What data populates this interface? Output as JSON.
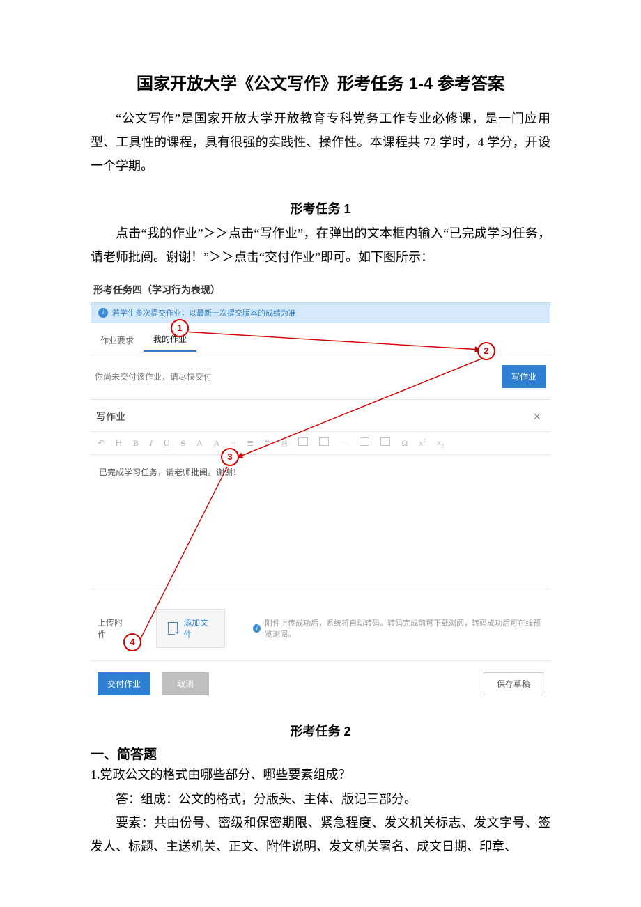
{
  "doc": {
    "title": "国家开放大学《公文写作》形考任务 1-4 参考答案",
    "intro": "“公文写作”是国家开放大学开放教育专科党务工作专业必修课，是一门应用型、工具性的课程，具有很强的实践性、操作性。本课程共 72 学时，4 学分，开设一个学期。",
    "task1_title": "形考任务 1",
    "task1_body": "点击“我的作业”＞＞点击“写作业”，在弹出的文本框内输入“已完成学习任务，请老师批阅。谢谢！”＞＞点击“交付作业”即可。如下图所示：",
    "task2_title": "形考任务 2",
    "q_section": "一、简答题",
    "q1": "1.党政公文的格式由哪些部分、哪些要素组成？",
    "a1_l1": "答：组成：公文的格式，分版头、主体、版记三部分。",
    "a1_l2": "要素：共由份号、密级和保密期限、紧急程度、发文机关标志、发文字号、签发人、标题、主送机关、正文、附件说明、发文机关署名、成文日期、印章、"
  },
  "mock": {
    "panel_title": "形考任务四（学习行为表现）",
    "info": "若学生多次提交作业，以最新一次提交版本的成绩为准",
    "tab_req": "作业要求",
    "tab_my": "我的作业",
    "not_submitted": "你尚未交付该作业，请尽快交付",
    "write_btn": "写作业",
    "editor_title": "写作业",
    "editor_content": "已完成学习任务，请老师批阅。谢谢！",
    "attach_label": "上传附件",
    "add_file": "添加文件",
    "attach_note": "附件上传成功后，系统将自动转码。转码完成前可下载浏阅，转码成功后可在线预览浏阅。",
    "submit_btn": "交付作业",
    "cancel_btn": "取消",
    "draft_btn": "保存草稿"
  },
  "callouts": {
    "c1": "1",
    "c2": "2",
    "c3": "3",
    "c4": "4"
  }
}
